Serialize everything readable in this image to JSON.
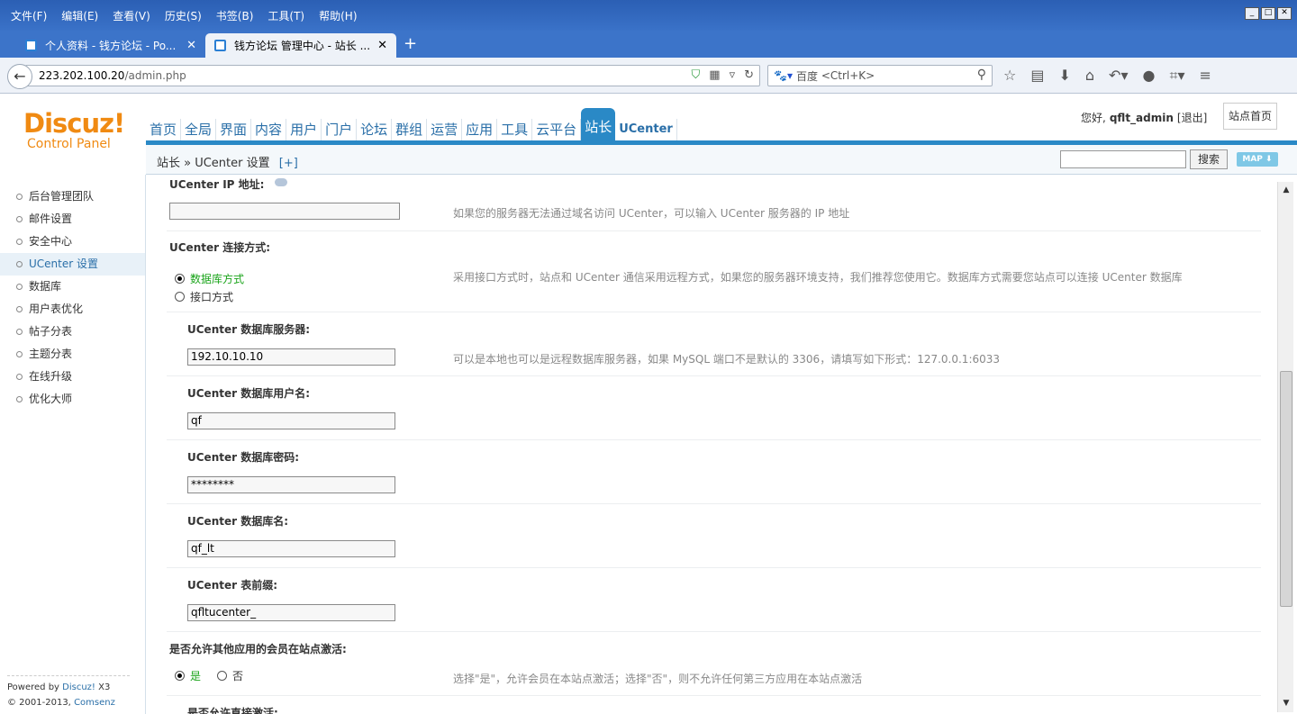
{
  "browser": {
    "menu": [
      "文件(F)",
      "编辑(E)",
      "查看(V)",
      "历史(S)",
      "书签(B)",
      "工具(T)",
      "帮助(H)"
    ],
    "tabs": [
      {
        "title": "个人资料 - 钱方论坛 - Po..."
      },
      {
        "title": "钱方论坛 管理中心 - 站长 ..."
      }
    ],
    "url_host": "223.202.100.20",
    "url_path": "/admin.php",
    "search_engine": "百度",
    "search_placeholder": "<Ctrl+K>"
  },
  "header": {
    "logo_brand": "Discuz!",
    "logo_sub": "Control Panel",
    "nav": [
      "首页",
      "全局",
      "界面",
      "内容",
      "用户",
      "门户",
      "论坛",
      "群组",
      "运营",
      "应用",
      "工具",
      "云平台",
      "站长",
      "UCenter"
    ],
    "active_nav": "站长",
    "greeting": "您好,",
    "username": "qflt_admin",
    "logout": "[退出]",
    "home_button": "站点首页",
    "breadcrumb": "站长 » UCenter 设置",
    "breadcrumb_plus": "[+]",
    "search_button": "搜索",
    "map_button": "MAP ⬇"
  },
  "sidebar": {
    "items": [
      "后台管理团队",
      "邮件设置",
      "安全中心",
      "UCenter 设置",
      "数据库",
      "用户表优化",
      "帖子分表",
      "主题分表",
      "在线升级",
      "优化大师"
    ],
    "active": "UCenter 设置",
    "footer_powered": "Powered by",
    "footer_brand": "Discuz!",
    "footer_version": "X3",
    "footer_copy": "© 2001-2013,",
    "footer_company": "Comsenz Inc."
  },
  "form": {
    "ip_label": "UCenter IP 地址:",
    "ip_value": "",
    "ip_tip": "如果您的服务器无法通过域名访问 UCenter，可以输入 UCenter 服务器的 IP 地址",
    "conn_label": "UCenter 连接方式:",
    "conn_options": [
      "数据库方式",
      "接口方式"
    ],
    "conn_tip": "采用接口方式时，站点和 UCenter 通信采用远程方式，如果您的服务器环境支持，我们推荐您使用它。数据库方式需要您站点可以连接 UCenter 数据库",
    "db_server_label": "UCenter 数据库服务器:",
    "db_server_value": "192.10.10.10",
    "db_server_tip": "可以是本地也可以是远程数据库服务器，如果 MySQL 端口不是默认的 3306，请填写如下形式：127.0.0.1:6033",
    "db_user_label": "UCenter 数据库用户名:",
    "db_user_value": "qf",
    "db_pass_label": "UCenter 数据库密码:",
    "db_pass_value": "********",
    "db_name_label": "UCenter 数据库名:",
    "db_name_value": "qf_lt",
    "prefix_label": "UCenter 表前缀:",
    "prefix_value": "qfltucenter_",
    "activate_label": "是否允许其他应用的会员在站点激活:",
    "activate_yes": "是",
    "activate_no": "否",
    "activate_tip": "选择\"是\"，允许会员在本站点激活；选择\"否\"，则不允许任何第三方应用在本站点激活",
    "next_label": "是否允许直接激活:"
  }
}
